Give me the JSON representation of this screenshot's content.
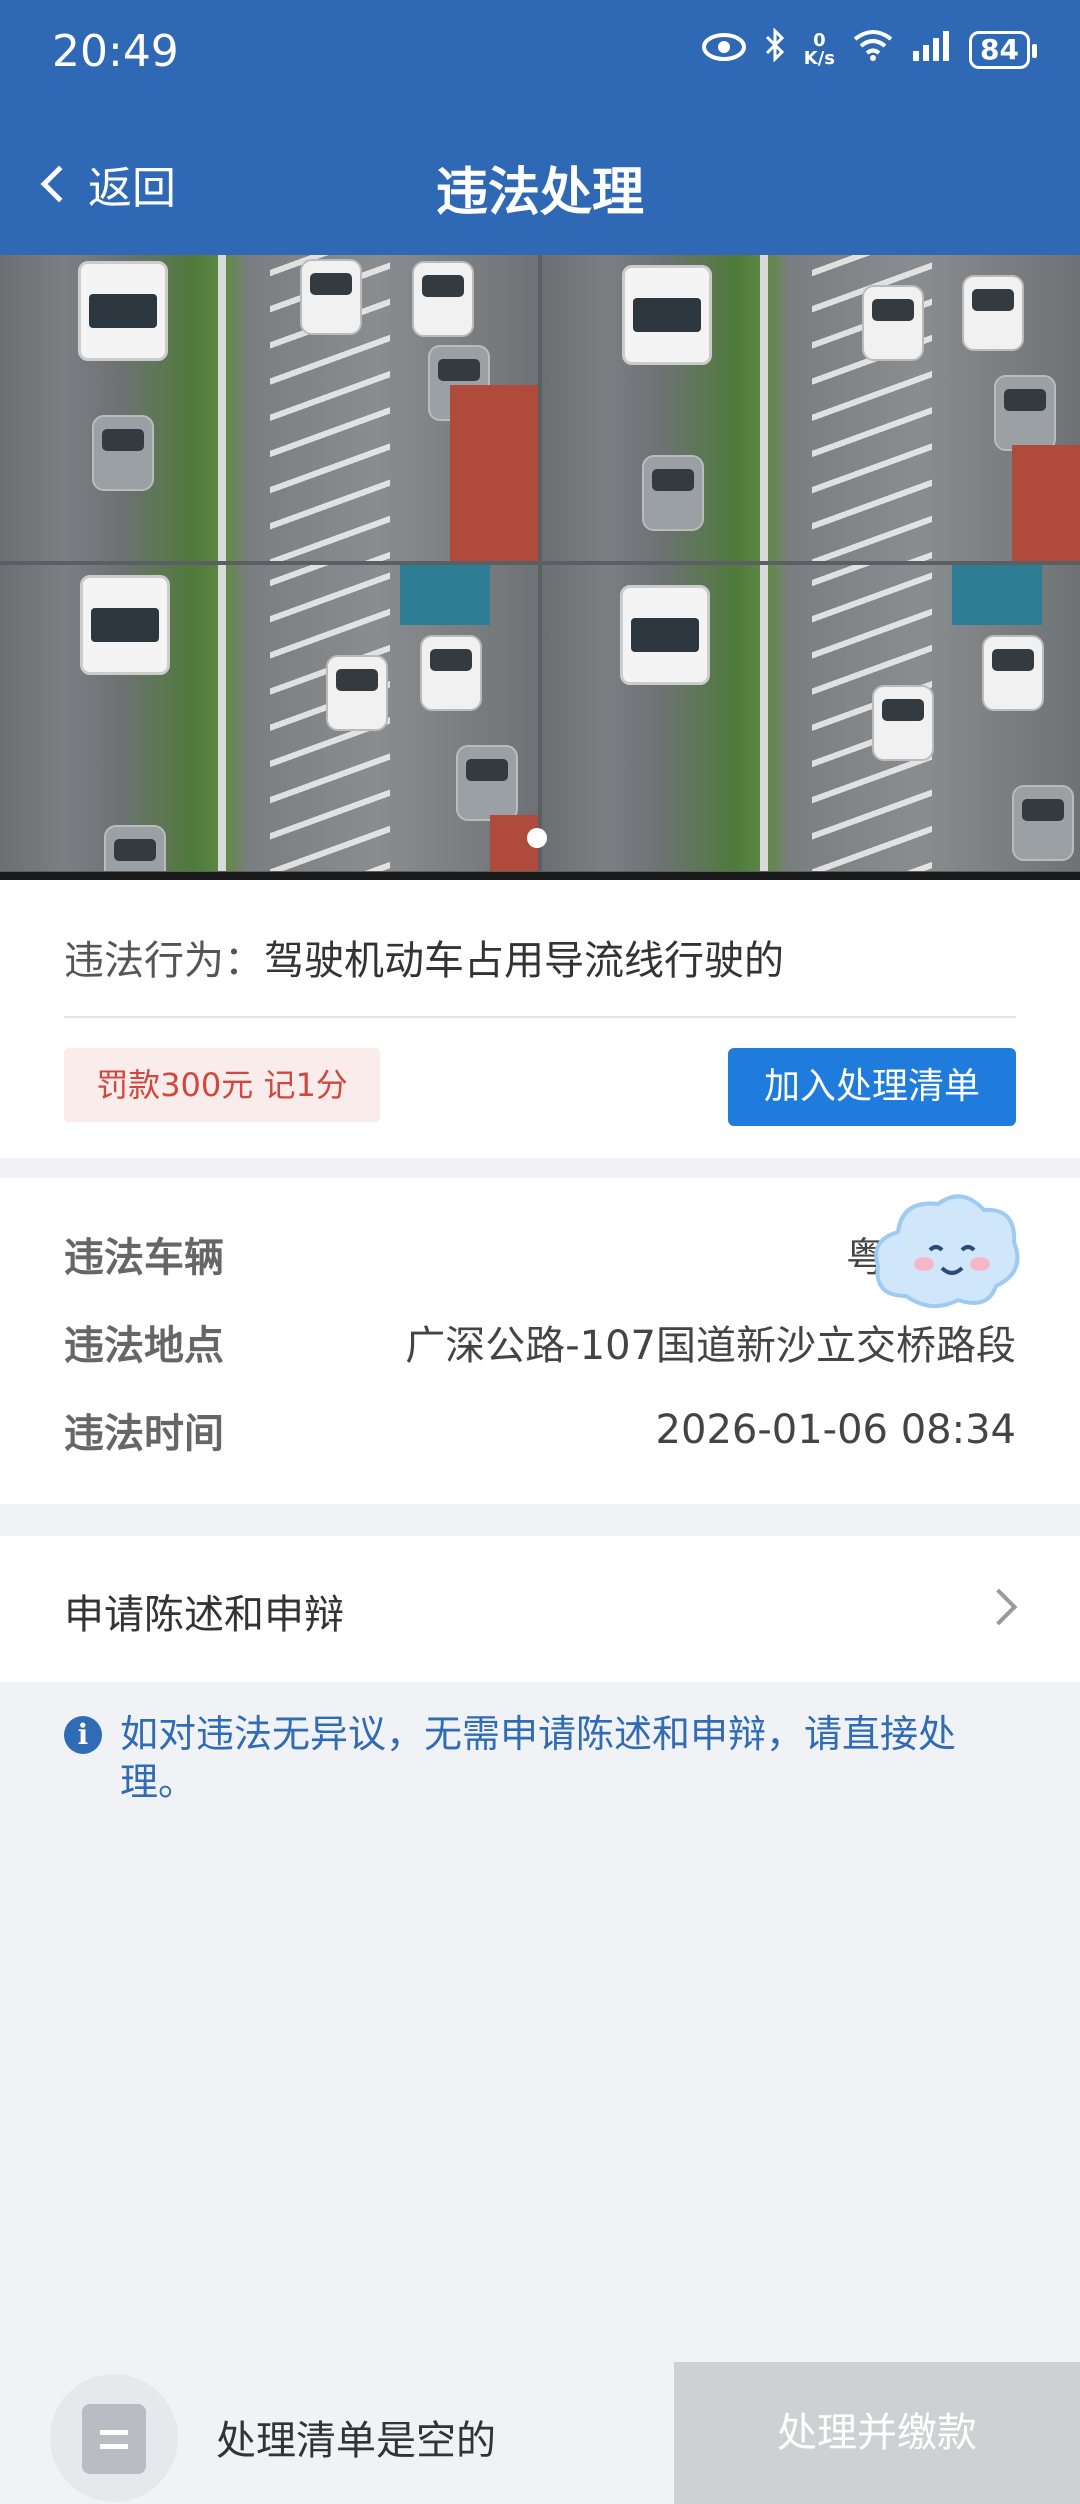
{
  "status_bar": {
    "time": "20:49",
    "speed_value": "0",
    "speed_unit": "K/s",
    "battery": "84"
  },
  "nav": {
    "back_label": "返回",
    "title": "违法处理"
  },
  "violation": {
    "behavior_label": "违法行为：",
    "behavior_value": "驾驶机动车占用导流线行驶的",
    "fine_badge": "罚款300元 记1分",
    "add_button": "加入处理清单"
  },
  "details": {
    "vehicle_label": "违法车辆",
    "vehicle_value": "粤",
    "location_label": "违法地点",
    "location_value": "广深公路-107国道新沙立交桥路段",
    "time_label": "违法时间",
    "time_value": "2026-01-06 08:34"
  },
  "appeal": {
    "label": "申请陈述和申辩"
  },
  "info": {
    "icon_glyph": "i",
    "text": "如对违法无异议，无需申请陈述和申辩，请直接处理。"
  },
  "bottom": {
    "empty_text": "处理清单是空的",
    "pay_button": "处理并缴款"
  },
  "colors": {
    "header_bg": "#2f68b5",
    "primary_button": "#1f7cdd",
    "fine_text": "#d2473d",
    "info_text": "#2f6cb5",
    "disabled_button": "#cfd0d4"
  }
}
